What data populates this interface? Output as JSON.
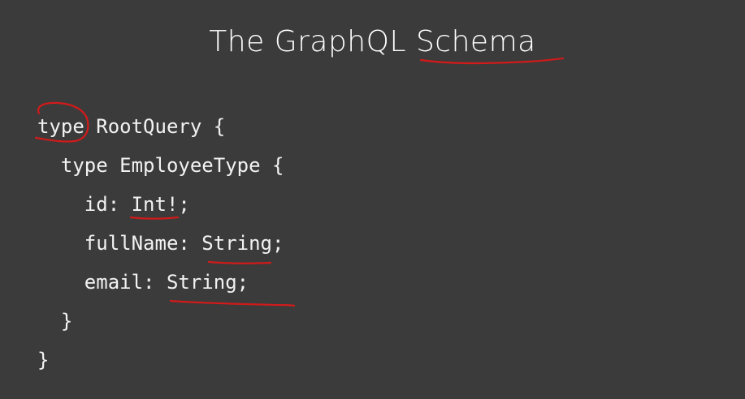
{
  "slide": {
    "title": "The GraphQL Schema",
    "code_lines": [
      "type RootQuery {",
      "  type EmployeeType {",
      "    id: Int!;",
      "    fullName: String;",
      "    email: String;",
      "  }",
      "}"
    ]
  },
  "colors": {
    "background": "#3b3b3b",
    "text": "#f2f2f2",
    "annotation_ink": "#d11a1a"
  }
}
